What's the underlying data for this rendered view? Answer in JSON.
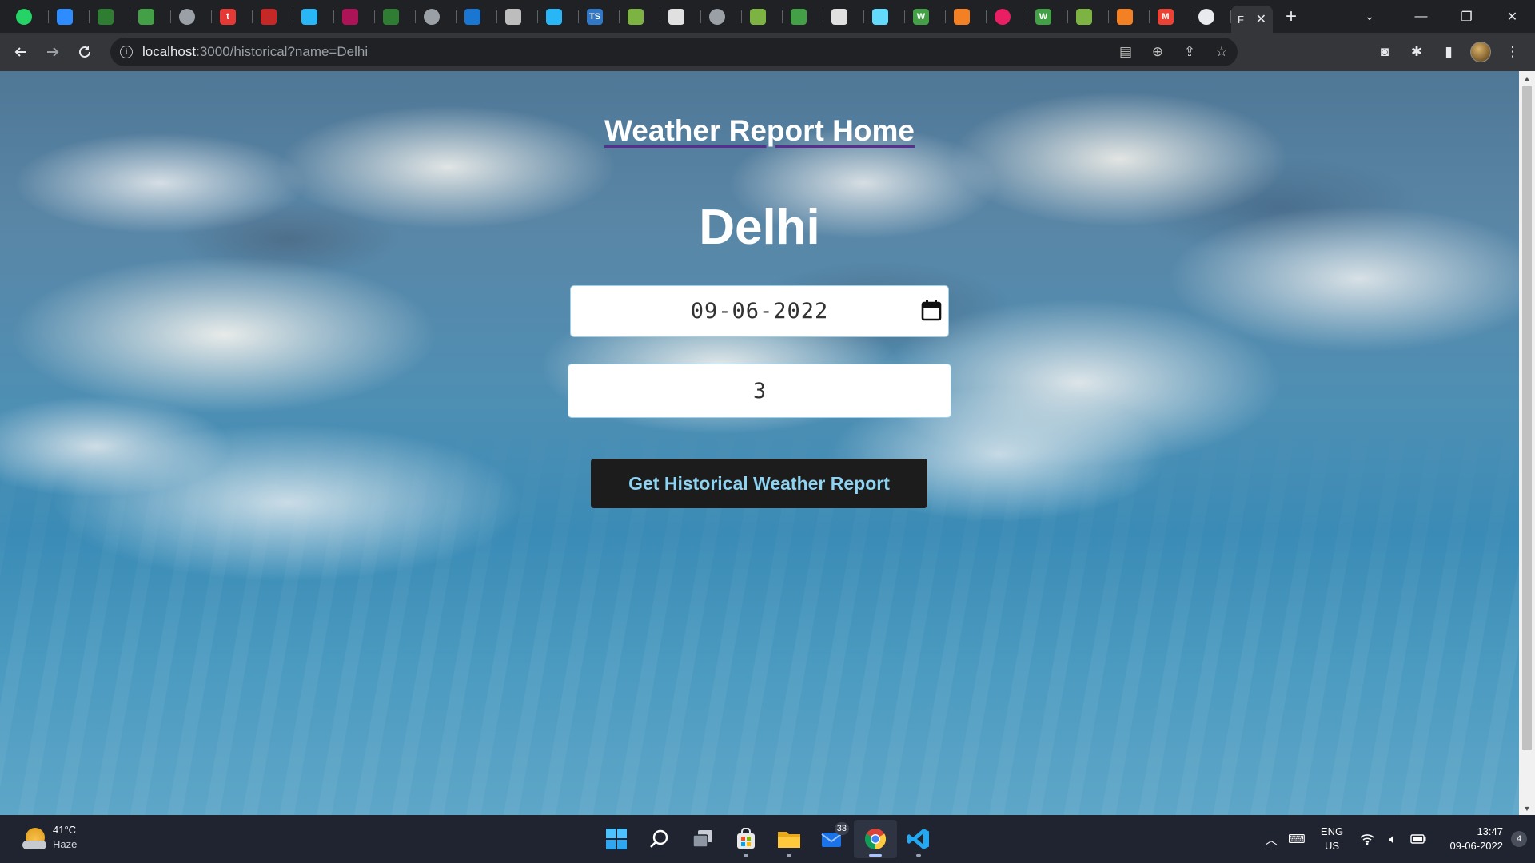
{
  "browser": {
    "pinned_tabs": [
      {
        "icon": "whatsapp-icon",
        "color": "#25d366",
        "glyph": ""
      },
      {
        "icon": "zoom-icon",
        "color": "#2d8cff",
        "glyph": ""
      },
      {
        "icon": "leaf-icon",
        "color": "#2e7d32",
        "glyph": ""
      },
      {
        "icon": "leaf-icon",
        "color": "#43a047",
        "glyph": ""
      },
      {
        "icon": "globe-icon",
        "color": "#9aa0a6",
        "glyph": ""
      },
      {
        "icon": "t-logo-icon",
        "color": "#e53935",
        "glyph": "t"
      },
      {
        "icon": "chart-icon",
        "color": "#c62828",
        "glyph": ""
      },
      {
        "icon": "snowflake-icon",
        "color": "#29b6f6",
        "glyph": ""
      },
      {
        "icon": "strawberry-icon",
        "color": "#ad1457",
        "glyph": ""
      },
      {
        "icon": "infinity-icon",
        "color": "#2e7d32",
        "glyph": ""
      },
      {
        "icon": "globe-icon",
        "color": "#9aa0a6",
        "glyph": ""
      },
      {
        "icon": "stats-icon",
        "color": "#1976d2",
        "glyph": ""
      },
      {
        "icon": "puzzle-icon",
        "color": "#bdbdbd",
        "glyph": ""
      },
      {
        "icon": "snowflake-icon",
        "color": "#29b6f6",
        "glyph": ""
      },
      {
        "icon": "typescript-icon",
        "color": "#3178c6",
        "glyph": "TS"
      },
      {
        "icon": "lightning-icon",
        "color": "#7cb342",
        "glyph": ""
      },
      {
        "icon": "box-icon",
        "color": "#e0e0e0",
        "glyph": ""
      },
      {
        "icon": "globe-icon",
        "color": "#9aa0a6",
        "glyph": ""
      },
      {
        "icon": "thumb-icon",
        "color": "#7cb342",
        "glyph": ""
      },
      {
        "icon": "leaf-icon",
        "color": "#43a047",
        "glyph": ""
      },
      {
        "icon": "cloud-icon",
        "color": "#e0e0e0",
        "glyph": ""
      },
      {
        "icon": "react-icon",
        "color": "#61dafb",
        "glyph": ""
      },
      {
        "icon": "w-logo-icon",
        "color": "#43a047",
        "glyph": "W"
      },
      {
        "icon": "stack-icon",
        "color": "#f48024",
        "glyph": ""
      },
      {
        "icon": "play-icon",
        "color": "#e91e63",
        "glyph": ""
      },
      {
        "icon": "w-logo-icon",
        "color": "#43a047",
        "glyph": "W"
      },
      {
        "icon": "lightning-icon",
        "color": "#7cb342",
        "glyph": ""
      },
      {
        "icon": "stack-icon",
        "color": "#f48024",
        "glyph": ""
      },
      {
        "icon": "gmail-icon",
        "color": "#ea4335",
        "glyph": "M"
      },
      {
        "icon": "github-icon",
        "color": "#e8eaed",
        "glyph": ""
      }
    ],
    "active_tab": {
      "title": "F",
      "close": "✕"
    },
    "url": {
      "host": "localhost",
      "rest": ":3000/historical?name=Delhi"
    }
  },
  "page": {
    "home_link": "Weather Report Home",
    "city": "Delhi",
    "date_value": "09-06-2022",
    "days_value": "3",
    "submit_label": "Get Historical Weather Report"
  },
  "taskbar": {
    "weather_temp": "41°C",
    "weather_desc": "Haze",
    "mail_badge": "33",
    "lang_line1": "ENG",
    "lang_line2": "US",
    "time": "13:47",
    "date": "09-06-2022",
    "notifications": "4"
  }
}
